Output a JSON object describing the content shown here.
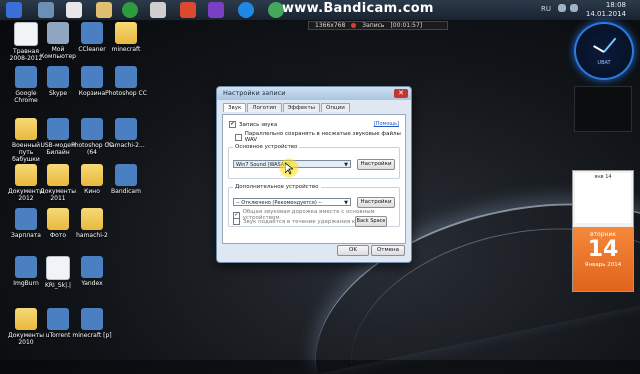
{
  "topbar": {
    "watermark": "www.Bandicam.com",
    "tray_lang": "RU",
    "time": "18:08",
    "date": "14.01.2014"
  },
  "recording": {
    "resolution": "1366x768",
    "status": "Запись",
    "elapsed": "[00:01:57]"
  },
  "desktop_icons": [
    {
      "label": "Травная 2008-2012",
      "kind": "doc"
    },
    {
      "label": "Мой Компьютер",
      "kind": "computer"
    },
    {
      "label": "CCleaner",
      "kind": "app"
    },
    {
      "label": "minecraft",
      "kind": "folder"
    },
    {
      "label": "Google Chrome",
      "kind": "app"
    },
    {
      "label": "Skype",
      "kind": "app"
    },
    {
      "label": "Корзина",
      "kind": "app"
    },
    {
      "label": "Photoshop CC",
      "kind": "app"
    },
    {
      "label": "Военный путь бабушки",
      "kind": "folder"
    },
    {
      "label": "USB-модем Билайн",
      "kind": "app"
    },
    {
      "label": "Photoshop CC (64",
      "kind": "app"
    },
    {
      "label": "hamachi-2...",
      "kind": "app"
    },
    {
      "label": "Документы 2012",
      "kind": "folder"
    },
    {
      "label": "Документы 2011",
      "kind": "folder"
    },
    {
      "label": "Кино",
      "kind": "folder"
    },
    {
      "label": "Bandicam",
      "kind": "app"
    },
    {
      "label": "Зарплата",
      "kind": "app"
    },
    {
      "label": "Фото",
      "kind": "folder"
    },
    {
      "label": "hamachi-2",
      "kind": "folder"
    },
    {
      "label": "ImgBurn",
      "kind": "app"
    },
    {
      "label": "KRI_Sk|.|",
      "kind": "doc"
    },
    {
      "label": "Yandex",
      "kind": "app"
    },
    {
      "label": "Документы 2010",
      "kind": "folder"
    },
    {
      "label": "uTorrent",
      "kind": "app"
    },
    {
      "label": "minecraft [p]",
      "kind": "app"
    }
  ],
  "dialog": {
    "title": "Настройки записи",
    "tabs": [
      "Звук",
      "Логотип",
      "Эффекты",
      "Опции"
    ],
    "help_link": "[Помощь]",
    "record_sound_label": "Запись звука",
    "record_sound_checked": true,
    "wav_label": "Параллельно сохранять в несжатые звуковые файлы WAV",
    "wav_checked": false,
    "primary_group": "Основное устройство",
    "primary_device": "Win7 Sound (WASAPI)",
    "settings_label": "Настройки",
    "secondary_group": "Дополнительное устройство",
    "secondary_device": "-- Отключено (Рекомендуется) --",
    "mix_label": "Общая звуковая дорожка вместе с основным устройством",
    "mix_checked": true,
    "hold_label": "Звук подаётся в течение удержания клавиши",
    "hold_checked": false,
    "hold_key": "Back Space",
    "ok_label": "OK",
    "cancel_label": "Отмена"
  },
  "gadgets": {
    "clock_label": "UBAT",
    "calendar_header": "янв 14",
    "weekday": "вторник",
    "day": "14",
    "month": "Январь 2014"
  }
}
